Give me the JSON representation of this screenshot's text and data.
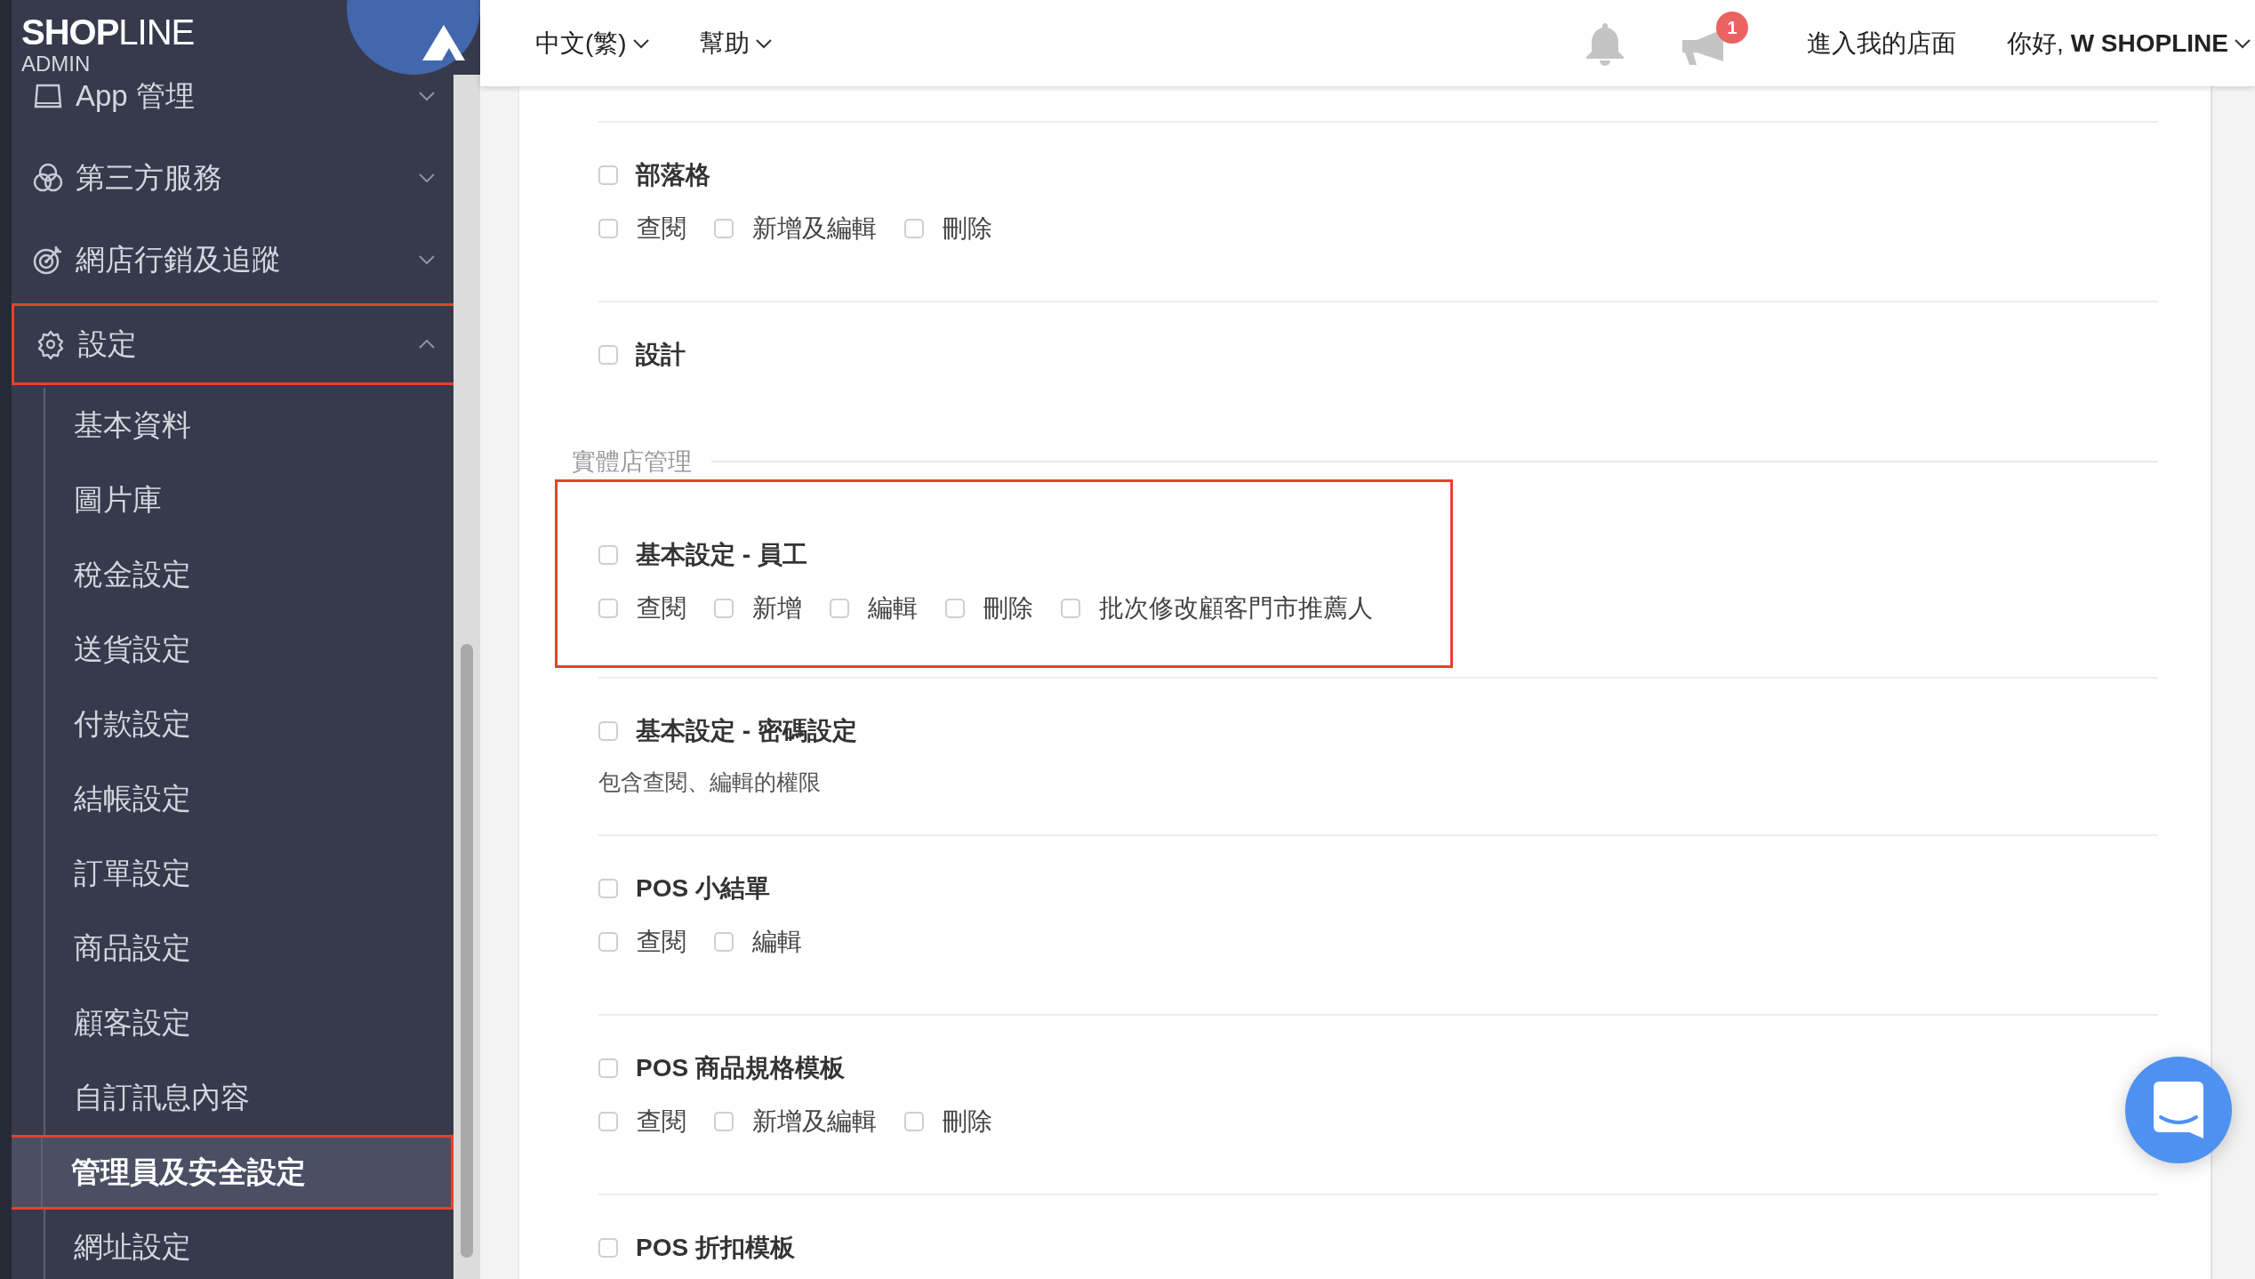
{
  "sidebar": {
    "logo": "**SHOP**LINE",
    "logo_sub": "ADMIN",
    "items": [
      {
        "label": "App 管埋",
        "expanded": false,
        "highlighted": false
      },
      {
        "label": "第三方服務",
        "expanded": false,
        "highlighted": false
      },
      {
        "label": "網店行銷及追蹤",
        "expanded": false,
        "highlighted": false
      },
      {
        "label": "設定",
        "expanded": true,
        "highlighted": true,
        "children": [
          {
            "label": "基本資料",
            "selected": false,
            "highlighted": false
          },
          {
            "label": "圖片庫",
            "selected": false,
            "highlighted": false
          },
          {
            "label": "稅金設定",
            "selected": false,
            "highlighted": false
          },
          {
            "label": "送貨設定",
            "selected": false,
            "highlighted": false
          },
          {
            "label": "付款設定",
            "selected": false,
            "highlighted": false
          },
          {
            "label": "結帳設定",
            "selected": false,
            "highlighted": false
          },
          {
            "label": "訂單設定",
            "selected": false,
            "highlighted": false
          },
          {
            "label": "商品設定",
            "selected": false,
            "highlighted": false
          },
          {
            "label": "顧客設定",
            "selected": false,
            "highlighted": false
          },
          {
            "label": "自訂訊息內容",
            "selected": false,
            "highlighted": false
          },
          {
            "label": "管理員及安全設定",
            "selected": true,
            "highlighted": true
          },
          {
            "label": "網址設定",
            "selected": false,
            "highlighted": false
          }
        ]
      }
    ]
  },
  "top_bar": {
    "language": "中文(繁)",
    "help": "幫助",
    "notification_badge": "1",
    "store_link": "進入我的店面",
    "greeting": "你好, **W SHOPLINE**"
  },
  "permissions": [
    {
      "kind": "permission",
      "title": "部落格",
      "checked": false,
      "highlighted": false,
      "options": [
        {
          "label": "查閱",
          "checked": false
        },
        {
          "label": "新增及編輯",
          "checked": false
        },
        {
          "label": "刪除",
          "checked": false
        }
      ]
    },
    {
      "kind": "permission",
      "title": "設計",
      "checked": false,
      "highlighted": false
    },
    {
      "kind": "group",
      "title": "實體店管理"
    },
    {
      "kind": "permission",
      "title": "基本設定 - 員工",
      "checked": false,
      "highlighted": true,
      "options": [
        {
          "label": "查閱",
          "checked": false
        },
        {
          "label": "新增",
          "checked": false
        },
        {
          "label": "編輯",
          "checked": false
        },
        {
          "label": "刪除",
          "checked": false
        },
        {
          "label": "批次修改顧客門市推薦人",
          "checked": false
        }
      ]
    },
    {
      "kind": "permission",
      "title": "基本設定 - 密碼設定",
      "checked": false,
      "highlighted": false,
      "description": "包含查閱、編輯的權限"
    },
    {
      "kind": "permission",
      "title": "POS 小結單",
      "checked": false,
      "highlighted": false,
      "options": [
        {
          "label": "查閱",
          "checked": false
        },
        {
          "label": "編輯",
          "checked": false
        }
      ]
    },
    {
      "kind": "permission",
      "title": "POS 商品規格模板",
      "checked": false,
      "highlighted": false,
      "options": [
        {
          "label": "查閱",
          "checked": false
        },
        {
          "label": "新增及編輯",
          "checked": false
        },
        {
          "label": "刪除",
          "checked": false
        }
      ]
    },
    {
      "kind": "permission",
      "title": "POS 折扣模板",
      "checked": false,
      "highlighted": false
    }
  ]
}
